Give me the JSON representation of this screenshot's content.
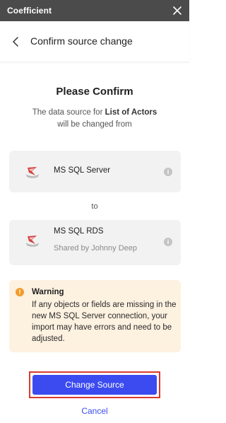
{
  "app": {
    "title": "Coefficient"
  },
  "header": {
    "title": "Confirm source change"
  },
  "confirm": {
    "title": "Please Confirm",
    "desc_prefix": "The data source for ",
    "desc_bold": "List of Actors",
    "desc_suffix": "will be changed from"
  },
  "source_from": {
    "name": "MS SQL Server",
    "icon": "sql-server-logo"
  },
  "connector_text": "to",
  "source_to": {
    "name": "MS SQL RDS",
    "subtitle": "Shared by Johnny Deep",
    "icon": "sql-server-logo"
  },
  "warning": {
    "title": "Warning",
    "text": "If any objects or fields are missing in the new MS SQL Server connection, your import may have errors and need to be adjusted."
  },
  "actions": {
    "primary": "Change Source",
    "cancel": "Cancel"
  },
  "colors": {
    "accent": "#3b4bf0",
    "topbar": "#4b4b4b",
    "warning_bg": "#fdf1e0",
    "warning_icon": "#f29b2c",
    "highlight": "#d83a2f"
  }
}
